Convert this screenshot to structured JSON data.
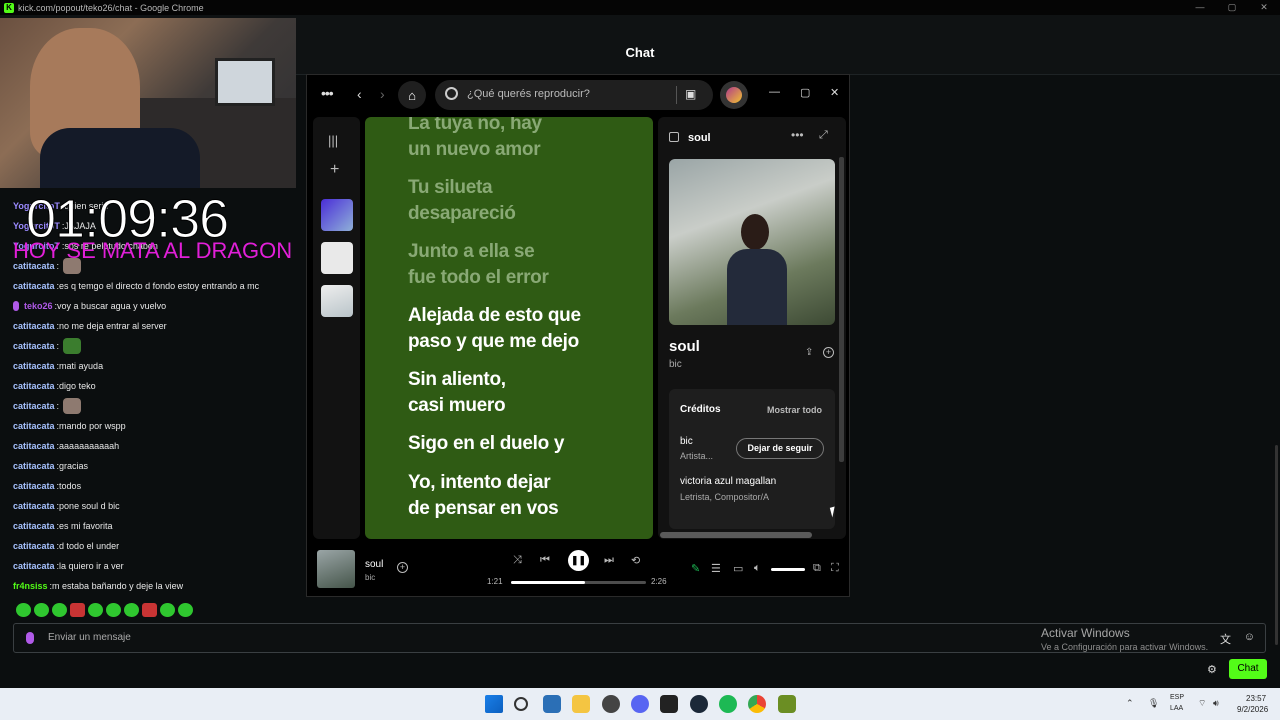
{
  "browser": {
    "title": "kick.com/popout/teko26/chat - Google Chrome",
    "controls": [
      "—",
      "▢",
      "✕"
    ]
  },
  "chat": {
    "header_title": "Chat",
    "overlay_timer": "01:09:36",
    "overlay_text": "HOY SE MATA AL DRAGON",
    "messages": [
      {
        "user": "YogurcitoT",
        "text": "quien serie",
        "color": "#9b8aff"
      },
      {
        "user": "YogurcitoT",
        "text": "JAJAJA",
        "color": "#9b8aff"
      },
      {
        "user": "YogurcitoT",
        "text": "sos re pelotudo chabon",
        "color": "#9b8aff"
      },
      {
        "user": "catitacata",
        "text": "",
        "emote": "cat",
        "color": "#a7c2ff"
      },
      {
        "user": "catitacata",
        "text": "es q temgo el directo d fondo estoy entrando a mc",
        "color": "#a7c2ff"
      },
      {
        "user": "teko26",
        "text": "voy a buscar agua y vuelvo",
        "color": "#b05ae8",
        "badge": true
      },
      {
        "user": "catitacata",
        "text": "no me deja entrar al server",
        "color": "#a7c2ff"
      },
      {
        "user": "catitacata",
        "text": "",
        "emote": "frog",
        "color": "#a7c2ff"
      },
      {
        "user": "catitacata",
        "text": "mati ayuda",
        "color": "#a7c2ff"
      },
      {
        "user": "catitacata",
        "text": "digo teko",
        "color": "#a7c2ff"
      },
      {
        "user": "catitacata",
        "text": "",
        "emote": "cat",
        "color": "#a7c2ff"
      },
      {
        "user": "catitacata",
        "text": "mando por wspp",
        "color": "#a7c2ff"
      },
      {
        "user": "catitacata",
        "text": "aaaaaaaaaaah",
        "color": "#a7c2ff"
      },
      {
        "user": "catitacata",
        "text": "gracias",
        "color": "#a7c2ff"
      },
      {
        "user": "catitacata",
        "text": "todos",
        "color": "#a7c2ff"
      },
      {
        "user": "catitacata",
        "text": "pone soul d bic",
        "color": "#a7c2ff"
      },
      {
        "user": "catitacata",
        "text": "es mi favorita",
        "color": "#a7c2ff"
      },
      {
        "user": "catitacata",
        "text": "d todo el under",
        "color": "#a7c2ff"
      },
      {
        "user": "catitacata",
        "text": "la quiero ir a ver",
        "color": "#a7c2ff"
      },
      {
        "user": "fr4nsiss",
        "text": "m estaba bañando y deje la view",
        "color": "#53fc18"
      }
    ],
    "input_placeholder": "Enviar un mensaje",
    "send_button": "Chat"
  },
  "watermark": {
    "line1": "Activar Windows",
    "line2": "Ve a Configuración para activar Windows."
  },
  "spotify": {
    "search_placeholder": "¿Qué querés reproducir?",
    "lyrics": [
      {
        "text": "La tuya no, hay\nun nuevo amor",
        "active": false
      },
      {
        "text": "Tu silueta\ndesapareció",
        "active": false
      },
      {
        "text": "Junto a ella se\nfue todo el error",
        "active": false
      },
      {
        "text": "Alejada de esto que\npaso y que me dejo",
        "active": true
      },
      {
        "text": "Sin aliento,\ncasi muero",
        "active": true
      },
      {
        "text": "Sigo en el duelo y",
        "active": true
      },
      {
        "text": "Yo, intento dejar\nde pensar en vos",
        "active": true
      }
    ],
    "panel": {
      "header": "soul",
      "song": "soul",
      "artist": "bic",
      "credits_title": "Créditos",
      "show_all": "Mostrar todo",
      "credits": [
        {
          "name": "bic",
          "role": "Artista..."
        },
        {
          "name": "victoria azul magallan",
          "role": "Letrista, Compositor/A"
        }
      ],
      "follow_button": "Dejar de seguir"
    },
    "player": {
      "track": "soul",
      "artist": "bic",
      "elapsed": "1:21",
      "duration": "2:26",
      "progress": 0.55
    }
  },
  "taskbar": {
    "lang_line1": "ESP",
    "lang_line2": "LAA",
    "time": "23:57",
    "date": "9/2/2026"
  }
}
